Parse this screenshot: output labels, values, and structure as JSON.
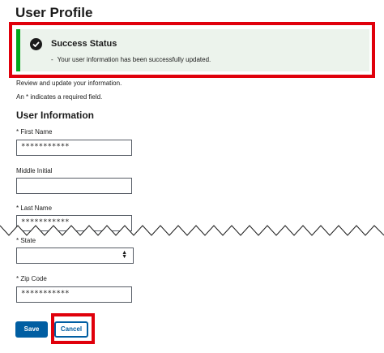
{
  "page": {
    "title": "User Profile"
  },
  "alert": {
    "heading": "Success Status",
    "bullet": "-",
    "message": "Your user information has been successfully updated.",
    "icon": "check-circle-icon",
    "accent_color": "#00a91c",
    "highlight_color": "#e0000b"
  },
  "form": {
    "intro": "Review and update your information.",
    "required_note": "An * indicates a required field.",
    "section_heading": "User Information",
    "first_name": {
      "label": "* First Name",
      "value": "***********"
    },
    "middle_initial": {
      "label": "Middle Initial",
      "value": ""
    },
    "last_name": {
      "label": "* Last Name",
      "value": "***********"
    },
    "state": {
      "label": "* State",
      "value": ""
    },
    "zip_code": {
      "label": "* Zip Code",
      "value": "***********"
    }
  },
  "actions": {
    "save_label": "Save",
    "cancel_label": "Cancel",
    "primary_color": "#005ea2"
  }
}
